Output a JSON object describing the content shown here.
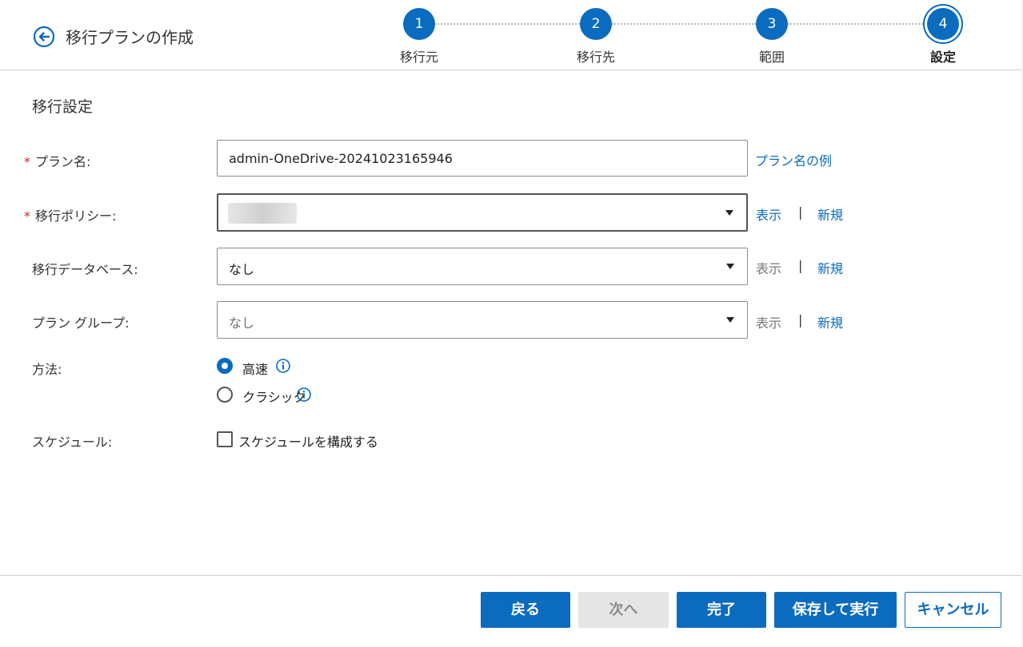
{
  "header": {
    "title": "移行プランの作成",
    "steps": [
      {
        "number": "1",
        "label": "移行元"
      },
      {
        "number": "2",
        "label": "移行先"
      },
      {
        "number": "3",
        "label": "範囲"
      },
      {
        "number": "4",
        "label": "設定"
      }
    ],
    "active_step": "4"
  },
  "section": {
    "title": "移行設定"
  },
  "form": {
    "required_mark": "*",
    "plan_name": {
      "label": "プラン名:",
      "value": "admin-OneDrive-20241023165946",
      "example_link": "プラン名の例"
    },
    "policy": {
      "label": "移行ポリシー:",
      "view_link": "表示",
      "separator": "|",
      "new_link": "新規"
    },
    "database": {
      "label": "移行データベース:",
      "value": "なし",
      "view_link": "表示",
      "separator": "|",
      "new_link": "新規"
    },
    "plan_group": {
      "label": "プラン グループ:",
      "value": "なし",
      "view_link": "表示",
      "separator": "|",
      "new_link": "新規"
    },
    "method": {
      "label": "方法:",
      "options": [
        {
          "label": "高速",
          "checked": true
        },
        {
          "label": "クラシック",
          "checked": false
        }
      ]
    },
    "schedule": {
      "label": "スケジュール:",
      "checkbox_label": "スケジュールを構成する",
      "checked": false
    }
  },
  "footer": {
    "back": "戻る",
    "next": "次へ",
    "finish": "完了",
    "save_run": "保存して実行",
    "cancel": "キャンセル"
  },
  "colors": {
    "accent": "#0b6bbf",
    "required": "#d9202c",
    "disabled_bg": "#e5e5e5"
  }
}
